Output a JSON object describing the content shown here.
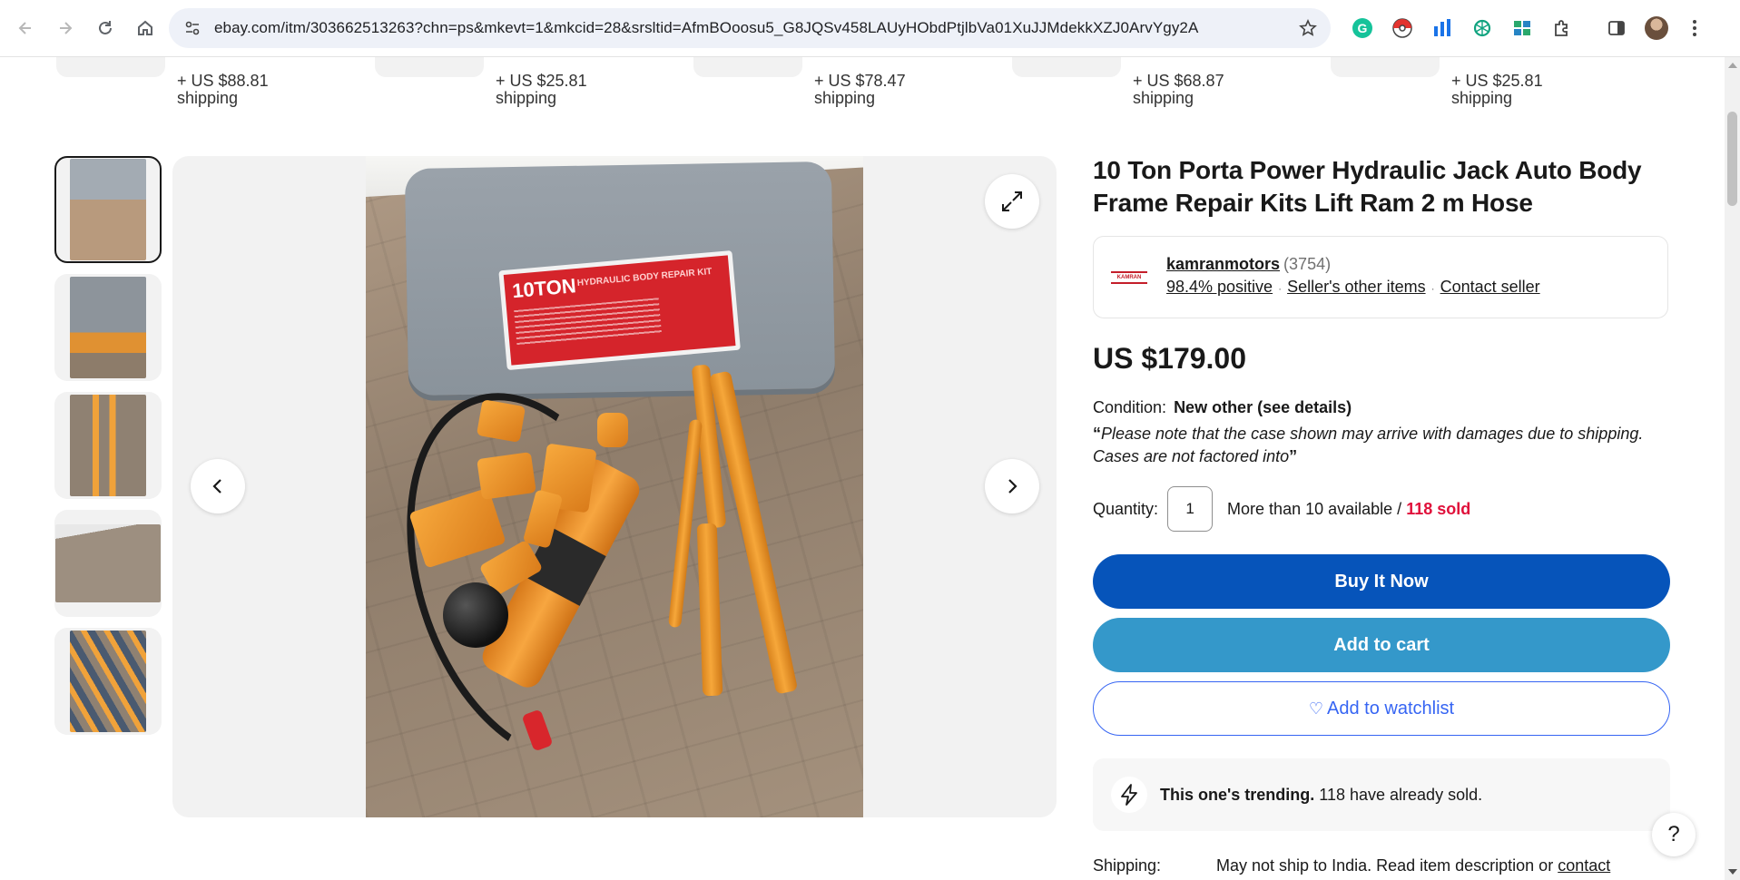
{
  "browser": {
    "url": "ebay.com/itm/303662513263?chn=ps&mkevt=1&mkcid=28&srsltid=AfmBOoosu5_G8JQSv458LAUyHObdPtjlbVa01XuJJMdekkXZJ0ArvYgy2A",
    "extensions": [
      "grammarly-icon",
      "pokeball-icon",
      "analytics-icon",
      "chatgpt-icon",
      "windows-icon",
      "extensions-puzzle-icon"
    ]
  },
  "recommendations": [
    {
      "shipping_line1": "+ US $88.81",
      "shipping_line2": "shipping"
    },
    {
      "shipping_line1": "+ US $25.81",
      "shipping_line2": "shipping"
    },
    {
      "shipping_line1": "+ US $78.47",
      "shipping_line2": "shipping"
    },
    {
      "shipping_line1": "+ US $68.87",
      "shipping_line2": "shipping"
    },
    {
      "shipping_line1": "+ US $25.81",
      "shipping_line2": "shipping"
    }
  ],
  "gallery": {
    "thumbnail_count": 5,
    "active_index": 0,
    "case_label": "10TON",
    "case_label_sub": "HYDRAULIC BODY REPAIR KIT"
  },
  "listing": {
    "title": "10 Ton Porta Power Hydraulic Jack Auto Body Frame Repair Kits Lift Ram 2 m Hose",
    "seller": {
      "name": "kamranmotors",
      "feedback_count": "(3754)",
      "positive": "98.4% positive",
      "other_items": "Seller's other items",
      "contact": "Contact seller"
    },
    "price": "US $179.00",
    "condition_label": "Condition:",
    "condition_value": "New other (see details)",
    "condition_note": "Please note that the case shown may arrive with damages due to shipping. Cases are not factored into",
    "quote_open": "“",
    "quote_close": "”",
    "quantity_label": "Quantity:",
    "quantity_value": "1",
    "available": "More than 10 available /",
    "sold": "118 sold",
    "buy_now": "Buy It Now",
    "add_to_cart": "Add to cart",
    "watchlist": "Add to watchlist",
    "trending_strong": "This one's trending.",
    "trending_rest": "118 have already sold.",
    "shipping_label": "Shipping:",
    "shipping_value": "May not ship to India. Read item description or",
    "shipping_link": "contact"
  },
  "help": "?",
  "colors": {
    "buy_now": "#0654ba",
    "add_to_cart": "#3498ca",
    "watchlist": "#3665f3",
    "sold": "#e0103a"
  }
}
